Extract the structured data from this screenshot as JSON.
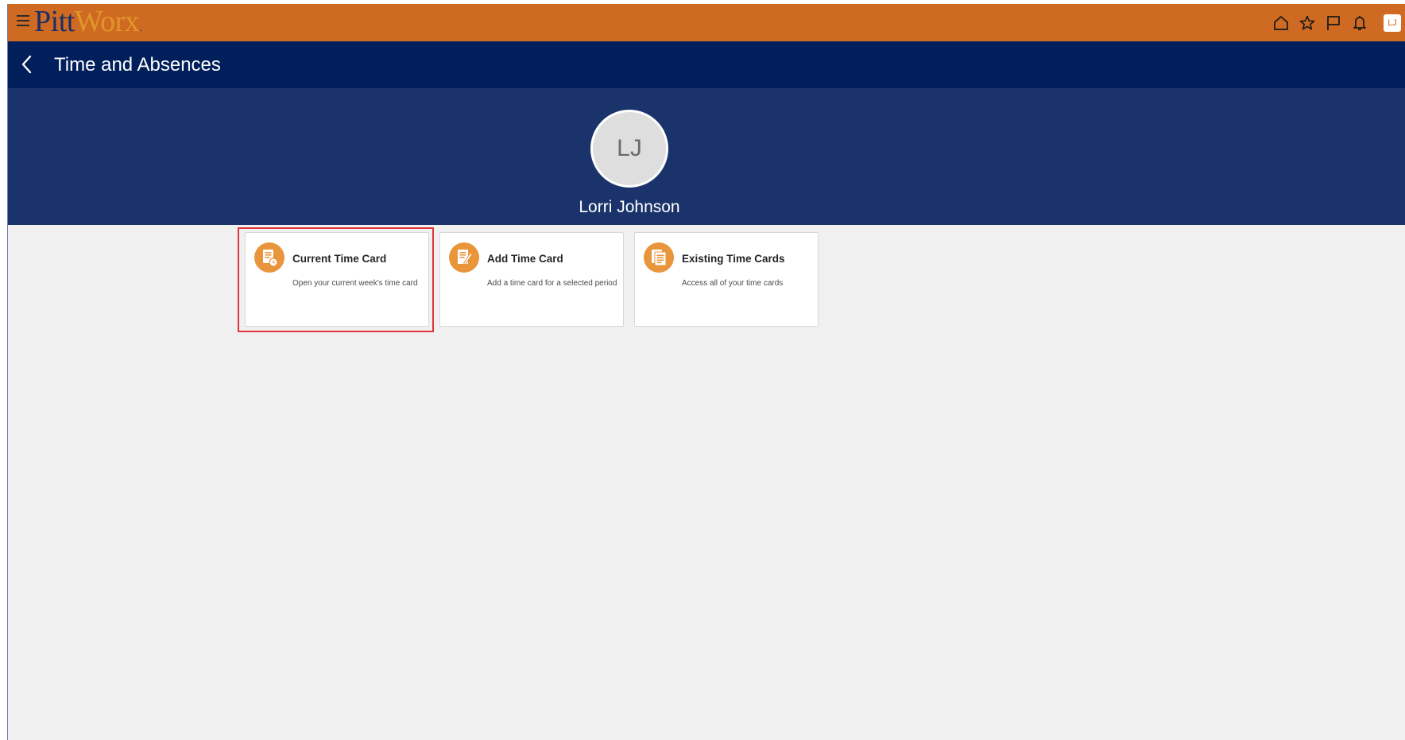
{
  "brand": {
    "name_part1": "Pitt",
    "name_part2": "Worx",
    "name_suffix": ".",
    "color_primary": "#cf6a22",
    "color_navy": "#1d2e66",
    "color_gold": "#e0952a"
  },
  "topbar": {
    "icons": [
      "menu-icon",
      "home-icon",
      "star-icon",
      "flag-icon",
      "bell-icon"
    ],
    "user_initials": "LJ"
  },
  "header": {
    "title": "Time and Absences",
    "back_icon": "chevron-left-icon",
    "color": "#001f5b"
  },
  "profile": {
    "initials": "LJ",
    "name": "Lorri Johnson",
    "banner_color": "#1b336b"
  },
  "cards": [
    {
      "title": "Current Time Card",
      "description": "Open your current week's time card",
      "icon": "timecard-clock-icon",
      "selected": true
    },
    {
      "title": "Add Time Card",
      "description": "Add a time card for a selected period",
      "icon": "edit-document-icon",
      "selected": false
    },
    {
      "title": "Existing Time Cards",
      "description": "Access all of your time cards",
      "icon": "document-stack-icon",
      "selected": false
    }
  ],
  "accent_icon_color": "#e8953c",
  "highlight_color": "#e0343a"
}
